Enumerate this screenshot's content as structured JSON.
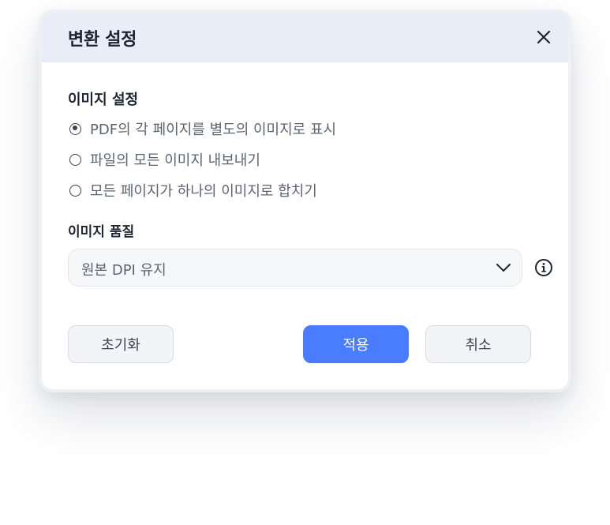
{
  "dialog": {
    "title": "변환 설정",
    "close_icon": "close-icon"
  },
  "image_settings": {
    "label": "이미지 설정",
    "options": [
      {
        "label": "PDF의 각 페이지를 별도의 이미지로 표시",
        "checked": true
      },
      {
        "label": "파일의 모든 이미지 내보내기",
        "checked": false
      },
      {
        "label": "모든 페이지가 하나의 이미지로 합치기",
        "checked": false
      }
    ]
  },
  "image_quality": {
    "label": "이미지 품질",
    "selected": "원본 DPI 유지",
    "dropdown_icon": "chevron-down-icon",
    "info_icon": "info-icon"
  },
  "buttons": {
    "reset": "초기화",
    "apply": "적용",
    "cancel": "취소"
  },
  "colors": {
    "accent": "#4a7cff",
    "header_bg": "#e9edf8",
    "text_primary": "#1d2433",
    "text_secondary": "#5b6473"
  }
}
